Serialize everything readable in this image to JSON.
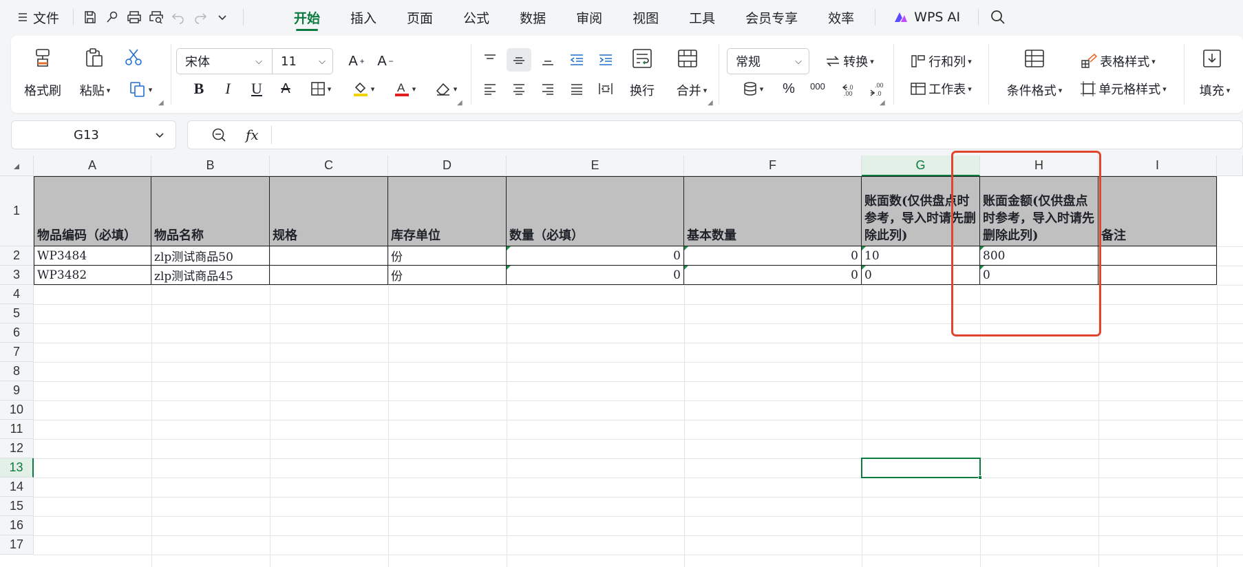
{
  "menubar": {
    "file_label": "文件",
    "tabs": [
      "开始",
      "插入",
      "页面",
      "公式",
      "数据",
      "审阅",
      "视图",
      "工具",
      "会员专享",
      "效率"
    ],
    "active_tab": "开始",
    "ai_label": "WPS AI"
  },
  "ribbon": {
    "format_painter": "格式刷",
    "paste": "粘贴",
    "font_name": "宋体",
    "font_size": "11",
    "wrap": "换行",
    "merge": "合并",
    "number_format": "常规",
    "convert": "转换",
    "row_col": "行和列",
    "worksheet": "工作表",
    "cond_format": "条件格式",
    "table_style": "表格样式",
    "cell_style": "单元格样式",
    "fill": "填充",
    "percent": "%",
    "thousands": "000"
  },
  "formula": {
    "cell_ref": "G13",
    "fx": "fx",
    "content": ""
  },
  "sheet": {
    "columns": [
      "A",
      "B",
      "C",
      "D",
      "E",
      "F",
      "G",
      "H",
      "I"
    ],
    "rows": [
      "1",
      "2",
      "3",
      "4",
      "5",
      "6",
      "7",
      "8",
      "9",
      "10",
      "11",
      "12",
      "13",
      "14",
      "15",
      "16",
      "17"
    ],
    "selected_cell": "G13",
    "header": {
      "A": "物品编码（必填）",
      "B": "物品名称",
      "C": "规格",
      "D": "库存单位",
      "E": "数量（必填）",
      "F": "基本数量",
      "G": "账面数(仅供盘点时参考，导入时请先删除此列)",
      "H": "账面金额(仅供盘点时参考，导入时请先删除此列)",
      "I": "备注"
    },
    "data_rows": [
      {
        "A": "WP3484",
        "B": "zlp测试商品50",
        "C": "",
        "D": "份",
        "E": "0",
        "F": "0",
        "G": "10",
        "H": "800",
        "I": ""
      },
      {
        "A": "WP3482",
        "B": "zlp测试商品45",
        "C": "",
        "D": "份",
        "E": "0",
        "F": "0",
        "G": "0",
        "H": "0",
        "I": ""
      }
    ]
  },
  "colors": {
    "accent": "#0a7a3e",
    "header_fill": "#c0c0c0",
    "highlight_box": "#e0452d"
  }
}
